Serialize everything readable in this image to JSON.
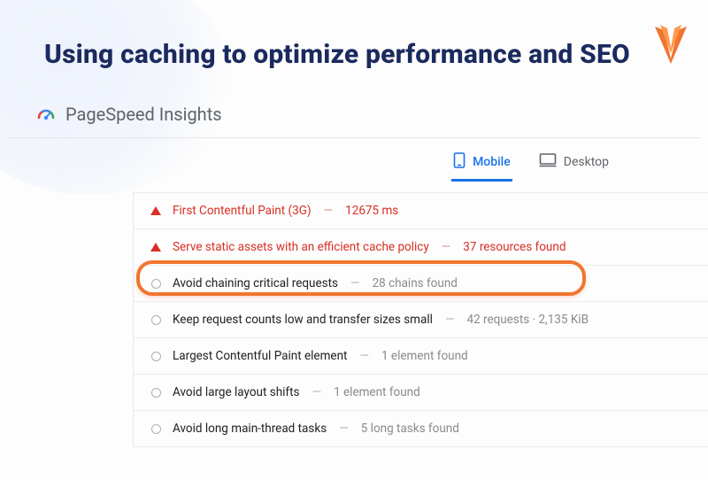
{
  "header": {
    "title": "Using caching to optimize performance and SEO"
  },
  "pagespeed": {
    "label": "PageSpeed Insights"
  },
  "tabs": {
    "mobile": "Mobile",
    "desktop": "Desktop",
    "active": "mobile"
  },
  "audits": [
    {
      "icon": "triangle",
      "warn": true,
      "label": "First Contentful Paint (3G)",
      "detail": "12675 ms"
    },
    {
      "icon": "triangle",
      "warn": true,
      "label": "Serve static assets with an efficient cache policy",
      "detail": "37 resources found"
    },
    {
      "icon": "circle",
      "warn": false,
      "label": "Avoid chaining critical requests",
      "detail": "28 chains found"
    },
    {
      "icon": "circle",
      "warn": false,
      "label": "Keep request counts low and transfer sizes small",
      "detail": "42 requests · 2,135 KiB"
    },
    {
      "icon": "circle",
      "warn": false,
      "label": "Largest Contentful Paint element",
      "detail": "1 element found"
    },
    {
      "icon": "circle",
      "warn": false,
      "label": "Avoid large layout shifts",
      "detail": "1 element found"
    },
    {
      "icon": "circle",
      "warn": false,
      "label": "Avoid long main-thread tasks",
      "detail": "5 long tasks found"
    }
  ],
  "highlight_index": 1,
  "colors": {
    "title": "#1b2a5e",
    "accent_blue": "#1a73e8",
    "warn_red": "#d93025",
    "highlight_orange": "#f1752f"
  }
}
